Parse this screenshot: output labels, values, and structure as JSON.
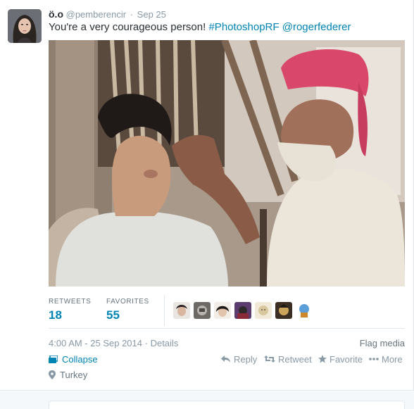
{
  "tweet": {
    "fullname": "ö.o",
    "username": "@pemberencir",
    "separator": "·",
    "date": "Sep 25",
    "text_plain": "You're a very courageous person!",
    "hashtag": "#PhotoshopRF",
    "mention": "@roger​federer",
    "mention_display": "@rogerfederer"
  },
  "stats": {
    "retweets_label": "RETWEETS",
    "retweets_count": "18",
    "favorites_label": "FAVORITES",
    "favorites_count": "55"
  },
  "meta": {
    "timestamp": "4:00 AM - 25 Sep 2014",
    "separator": "·",
    "details": "Details",
    "flag_media": "Flag media"
  },
  "actions": {
    "collapse": "Collapse",
    "reply": "Reply",
    "retweet": "Retweet",
    "favorite": "Favorite",
    "more": "More"
  },
  "location": "Turkey",
  "colors": {
    "link": "#0084b4",
    "muted": "#8899a6",
    "text": "#292f33",
    "border": "#e1e8ed"
  },
  "icons": [
    "collapse-icon",
    "reply-icon",
    "retweet-icon",
    "favorite-star-icon",
    "more-dots-icon",
    "location-pin-icon"
  ]
}
